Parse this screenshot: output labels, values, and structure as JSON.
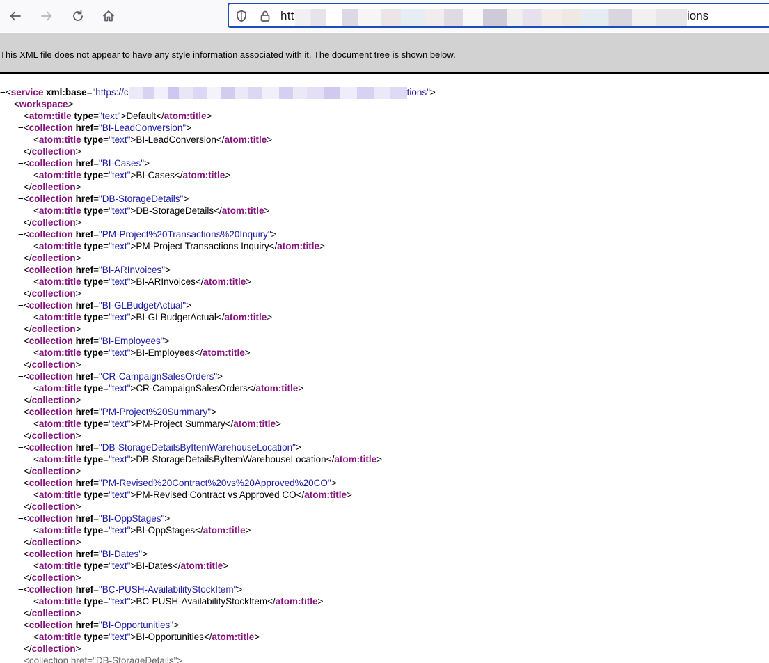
{
  "toolbar": {
    "icons": [
      "back-arrow-icon",
      "forward-arrow-icon",
      "reload-icon",
      "home-icon",
      "shield-icon",
      "lock-icon"
    ],
    "url_start": "htt",
    "url_end": "ions"
  },
  "banner": {
    "text": "This XML file does not appear to have any style information associated with it. The document tree is shown below."
  },
  "xml": {
    "fold_symbol": "−",
    "service_tag": "service",
    "service_attr": "xml:base",
    "service_value_start": "\"https://c",
    "service_value_end": "tions\"",
    "workspace_tag": "workspace",
    "title_tag": "atom:title",
    "title_type_attr": "type",
    "title_type_value": "\"text\"",
    "workspace_title": "Default",
    "collection_tag": "collection",
    "href_attr": "href",
    "collections": [
      {
        "href": "\"BI-LeadConversion\"",
        "title": "BI-LeadConversion"
      },
      {
        "href": "\"BI-Cases\"",
        "title": "BI-Cases"
      },
      {
        "href": "\"DB-StorageDetails\"",
        "title": "DB-StorageDetails"
      },
      {
        "href": "\"PM-Project%20Transactions%20Inquiry\"",
        "title": "PM-Project Transactions Inquiry"
      },
      {
        "href": "\"BI-ARInvoices\"",
        "title": "BI-ARInvoices"
      },
      {
        "href": "\"BI-GLBudgetActual\"",
        "title": "BI-GLBudgetActual"
      },
      {
        "href": "\"BI-Employees\"",
        "title": "BI-Employees"
      },
      {
        "href": "\"CR-CampaignSalesOrders\"",
        "title": "CR-CampaignSalesOrders"
      },
      {
        "href": "\"PM-Project%20Summary\"",
        "title": "PM-Project Summary"
      },
      {
        "href": "\"DB-StorageDetailsByItemWarehouseLocation\"",
        "title": "DB-StorageDetailsByItemWarehouseLocation"
      },
      {
        "href": "\"PM-Revised%20Contract%20vs%20Approved%20CO\"",
        "title": "PM-Revised Contract vs Approved CO"
      },
      {
        "href": "\"BI-OppStages\"",
        "title": "BI-OppStages"
      },
      {
        "href": "\"BI-Dates\"",
        "title": "BI-Dates"
      },
      {
        "href": "\"BC-PUSH-AvailabilityStockItem\"",
        "title": "BC-PUSH-AvailabilityStockItem"
      },
      {
        "href": "\"BI-Opportunities\"",
        "title": "BI-Opportunities"
      }
    ],
    "partial_last": "<collection href=\"DB-StorageDetails\">"
  },
  "colors": {
    "tag": "#881280",
    "value": "#1a1aa6",
    "banner_bg": "#d2d2d2",
    "url_focus": "#1b4fb6"
  }
}
